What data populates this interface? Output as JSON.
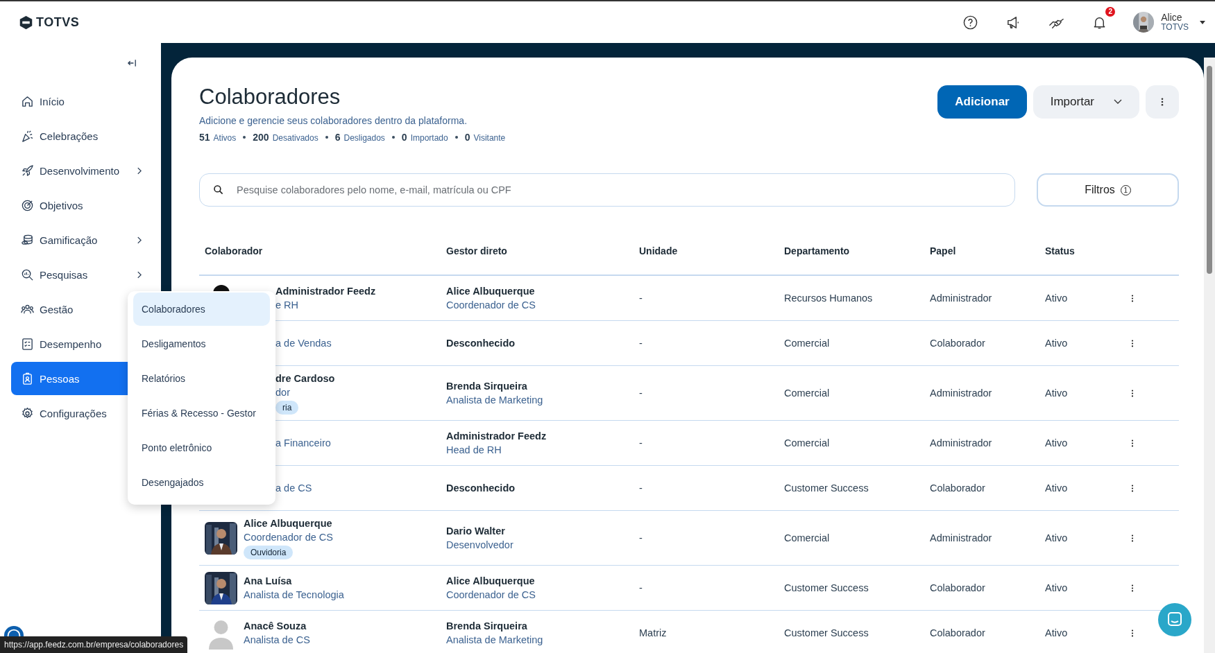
{
  "header": {
    "logo_text": "TOTVS",
    "notifications": "2",
    "user": {
      "name": "Alice",
      "org": "TOTVS"
    }
  },
  "sidebar": {
    "items": [
      {
        "label": "Início",
        "has_children": false,
        "selected": false
      },
      {
        "label": "Celebrações",
        "has_children": false,
        "selected": false
      },
      {
        "label": "Desenvolvimento",
        "has_children": true,
        "selected": false
      },
      {
        "label": "Objetivos",
        "has_children": false,
        "selected": false
      },
      {
        "label": "Gamificação",
        "has_children": true,
        "selected": false
      },
      {
        "label": "Pesquisas",
        "has_children": true,
        "selected": false
      },
      {
        "label": "Gestão",
        "has_children": false,
        "selected": false
      },
      {
        "label": "Desempenho",
        "has_children": false,
        "selected": false
      },
      {
        "label": "Pessoas",
        "has_children": false,
        "selected": true
      },
      {
        "label": "Configurações",
        "has_children": false,
        "selected": false
      }
    ]
  },
  "submenu": [
    {
      "label": "Colaboradores",
      "selected": true
    },
    {
      "label": "Desligamentos",
      "selected": false
    },
    {
      "label": "Relatórios",
      "selected": false
    },
    {
      "label": "Férias & Recesso - Gestor",
      "selected": false
    },
    {
      "label": "Ponto eletrônico",
      "selected": false
    },
    {
      "label": "Desengajados",
      "selected": false
    }
  ],
  "page": {
    "title": "Colaboradores",
    "subtitle": "Adicione e gerencie seus colaboradores dentro da plataforma.",
    "stats": [
      {
        "count": "51",
        "label": "Ativos"
      },
      {
        "count": "200",
        "label": "Desativados"
      },
      {
        "count": "6",
        "label": "Desligados"
      },
      {
        "count": "0",
        "label": "Importado"
      },
      {
        "count": "0",
        "label": "Visitante"
      }
    ],
    "buttons": {
      "add": "Adicionar",
      "import": "Importar"
    },
    "search": {
      "placeholder": "Pesquise colaboradores pelo nome, e-mail, matrícula ou CPF"
    },
    "filters": {
      "label": "Filtros",
      "count": "1"
    }
  },
  "table": {
    "columns": [
      "Colaborador",
      "Gestor direto",
      "Unidade",
      "Departamento",
      "Papel",
      "Status"
    ],
    "rows": [
      {
        "covered": true,
        "kind": "silhouette",
        "name": "Administrador Feedz",
        "role": "e RH",
        "manager": "Alice Albuquerque",
        "manager_role": "Coordenador de CS",
        "unit": "-",
        "department": "Recursos Humanos",
        "papel": "Administrador",
        "status": "Ativo"
      },
      {
        "covered": true,
        "role": "a de Vendas",
        "manager": "Desconhecido",
        "unit": "-",
        "department": "Comercial",
        "papel": "Colaborador",
        "status": "Ativo"
      },
      {
        "covered": true,
        "name": "dre Cardoso",
        "role": "dor",
        "tag": "ria",
        "manager": "Brenda Sirqueira",
        "manager_role": "Analista de Marketing",
        "unit": "-",
        "department": "Comercial",
        "papel": "Administrador",
        "status": "Ativo"
      },
      {
        "covered": true,
        "role": "a Financeiro",
        "manager": "Administrador Feedz",
        "manager_role": "Head de RH",
        "unit": "-",
        "department": "Comercial",
        "papel": "Administrador",
        "status": "Ativo"
      },
      {
        "covered": true,
        "role": "a de CS",
        "manager": "Desconhecido",
        "unit": "-",
        "department": "Customer Success",
        "papel": "Colaborador",
        "status": "Ativo"
      },
      {
        "covered": false,
        "name": "Alice Albuquerque",
        "role": "Coordenador de CS",
        "tag": "Ouvidoria",
        "manager": "Dario Walter",
        "manager_role": "Desenvolvedor",
        "unit": "-",
        "department": "Comercial",
        "papel": "Administrador",
        "status": "Ativo"
      },
      {
        "covered": false,
        "name": "Ana Luísa",
        "role": "Analista de Tecnologia",
        "manager": "Alice Albuquerque",
        "manager_role": "Coordenador de CS",
        "unit": "-",
        "department": "Customer Success",
        "papel": "Colaborador",
        "status": "Ativo"
      },
      {
        "covered": false,
        "kind": "placeholder",
        "name": "Anacê Souza",
        "role": "Analista de CS",
        "manager": "Brenda Sirqueira",
        "manager_role": "Analista de Marketing",
        "unit": "Matriz",
        "department": "Customer Success",
        "papel": "Colaborador",
        "status": "Ativo"
      }
    ]
  },
  "status_url": "https://app.feedz.com.br/empresa/colaboradores"
}
